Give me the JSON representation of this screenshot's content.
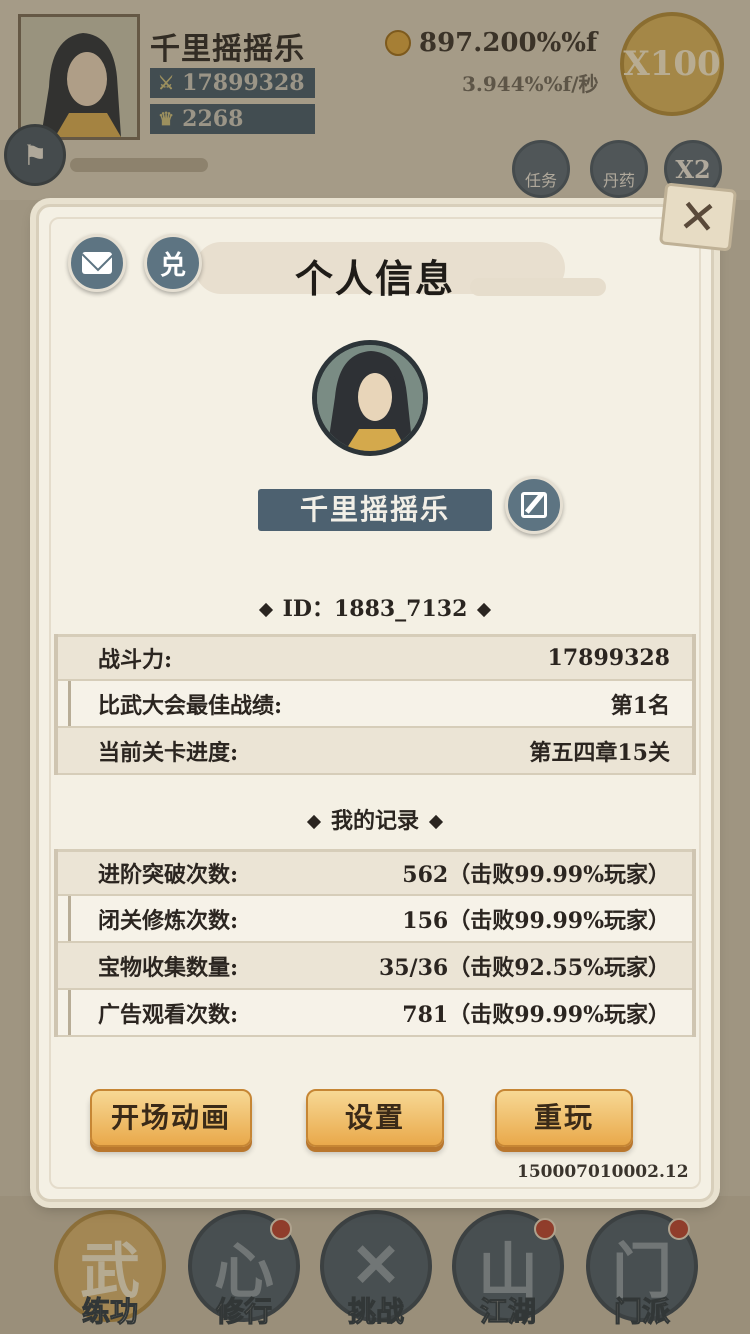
{
  "background": {
    "player_name": "千里摇摇乐",
    "combat_power": "17899328",
    "ingots": "2268",
    "gold_amount": "897.200%%f",
    "gold_rate": "3.944%%f/秒",
    "multiplier_button": "X100",
    "side_buttons": [
      "任务",
      "丹药",
      "X2"
    ],
    "bottom_nav": [
      {
        "label": "练功",
        "glyph": "武"
      },
      {
        "label": "修行",
        "glyph": "心"
      },
      {
        "label": "挑战",
        "glyph": "✕"
      },
      {
        "label": "江湖",
        "glyph": "山"
      },
      {
        "label": "门派",
        "glyph": "门"
      }
    ]
  },
  "modal": {
    "title": "个人信息",
    "redeem_label": "兑",
    "player_name": "千里摇摇乐",
    "id_text": "ID：1883_7132",
    "stats": [
      {
        "label": "战斗力:",
        "value": "17899328"
      },
      {
        "label": "比武大会最佳战绩:",
        "value": "第1名"
      },
      {
        "label": "当前关卡进度:",
        "value": "第五四章15关"
      }
    ],
    "records_title": "我的记录",
    "records": [
      {
        "label": "进阶突破次数:",
        "value": "562（击败99.99%玩家）"
      },
      {
        "label": "闭关修炼次数:",
        "value": "156（击败99.99%玩家）"
      },
      {
        "label": "宝物收集数量:",
        "value": "35/36（击败92.55%玩家）"
      },
      {
        "label": "广告观看次数:",
        "value": "781（击败99.99%玩家）"
      }
    ],
    "buttons": {
      "opening": "开场动画",
      "settings": "设置",
      "replay": "重玩"
    },
    "version": "150007010002.12"
  },
  "colors": {
    "modal_bg": "#f4f0e4",
    "slate_button": "#5d7482",
    "name_plate": "#4d6170",
    "orange_button": "#e9a94b"
  }
}
